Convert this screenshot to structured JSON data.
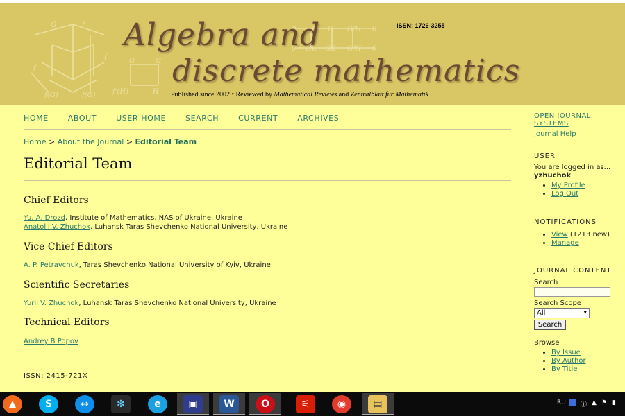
{
  "header": {
    "title_line1": "Algebra and",
    "title_line2": "discrete mathematics",
    "issn": "ISSN: 1726-3255",
    "published_prefix": "Published since 2002 • Reviewed by ",
    "published_mr": "Mathematical Reviews",
    "published_and": " and ",
    "published_zb": "Zentralblatt für Mathematik"
  },
  "nav": {
    "items": [
      "HOME",
      "ABOUT",
      "USER HOME",
      "SEARCH",
      "CURRENT",
      "ARCHIVES"
    ]
  },
  "breadcrumb": {
    "home": "Home",
    "sep": ">",
    "about": "About the Journal",
    "current": "Editorial Team"
  },
  "page": {
    "title": "Editorial Team",
    "issn": "ISSN: 2415-721X"
  },
  "sections": {
    "chief": {
      "heading": "Chief Editors",
      "members": [
        {
          "name": "Yu. A. Drozd",
          "affiliation": ", Institute of Mathematics, NAS of Ukraine, Ukraine"
        },
        {
          "name": "Anatolii V. Zhuchok",
          "affiliation": ", Luhansk Taras Shevchenko National University, Ukraine"
        }
      ]
    },
    "vice": {
      "heading": "Vice Chief Editors",
      "members": [
        {
          "name": "A. P. Petravchuk",
          "affiliation": ", Taras Shevchenko National University of Kyiv, Ukraine"
        }
      ]
    },
    "secretaries": {
      "heading": "Scientific Secretaries",
      "members": [
        {
          "name": "Yurii V. Zhuchok",
          "affiliation": ", Luhansk Taras Shevchenko National University, Ukraine"
        }
      ]
    },
    "technical": {
      "heading": "Technical Editors",
      "members": [
        {
          "name": "Andrey B Popov",
          "affiliation": ""
        }
      ]
    }
  },
  "sidebar": {
    "ojs": "OPEN JOURNAL SYSTEMS",
    "help": "Journal Help",
    "user_title": "USER",
    "logged_in": "You are logged in as...",
    "username": "yzhuchok",
    "my_profile": "My Profile",
    "log_out": "Log Out",
    "notifications_title": "NOTIFICATIONS",
    "view": "View",
    "view_count": " (1213 new)",
    "manage": "Manage",
    "content_title": "JOURNAL CONTENT",
    "search_label": "Search",
    "scope_label": "Search Scope",
    "scope_value": "All",
    "search_button": "Search",
    "browse_label": "Browse",
    "by_issue": "By Issue",
    "by_author": "By Author",
    "by_title": "By Title"
  },
  "taskbar": {
    "lang": "RU",
    "icons": [
      "avast-icon",
      "skype-icon",
      "teamviewer-icon",
      "paint-icon",
      "edge-icon",
      "floppy-icon",
      "word-icon",
      "opera-icon",
      "acrobat-icon",
      "chrome-icon",
      "explorer-icon"
    ],
    "word_label": "W"
  },
  "colors": {
    "page_bg": "#ffff99",
    "header_bg": "#d9c766",
    "link": "#2b7a6b",
    "title_brown": "#6b4a34"
  }
}
